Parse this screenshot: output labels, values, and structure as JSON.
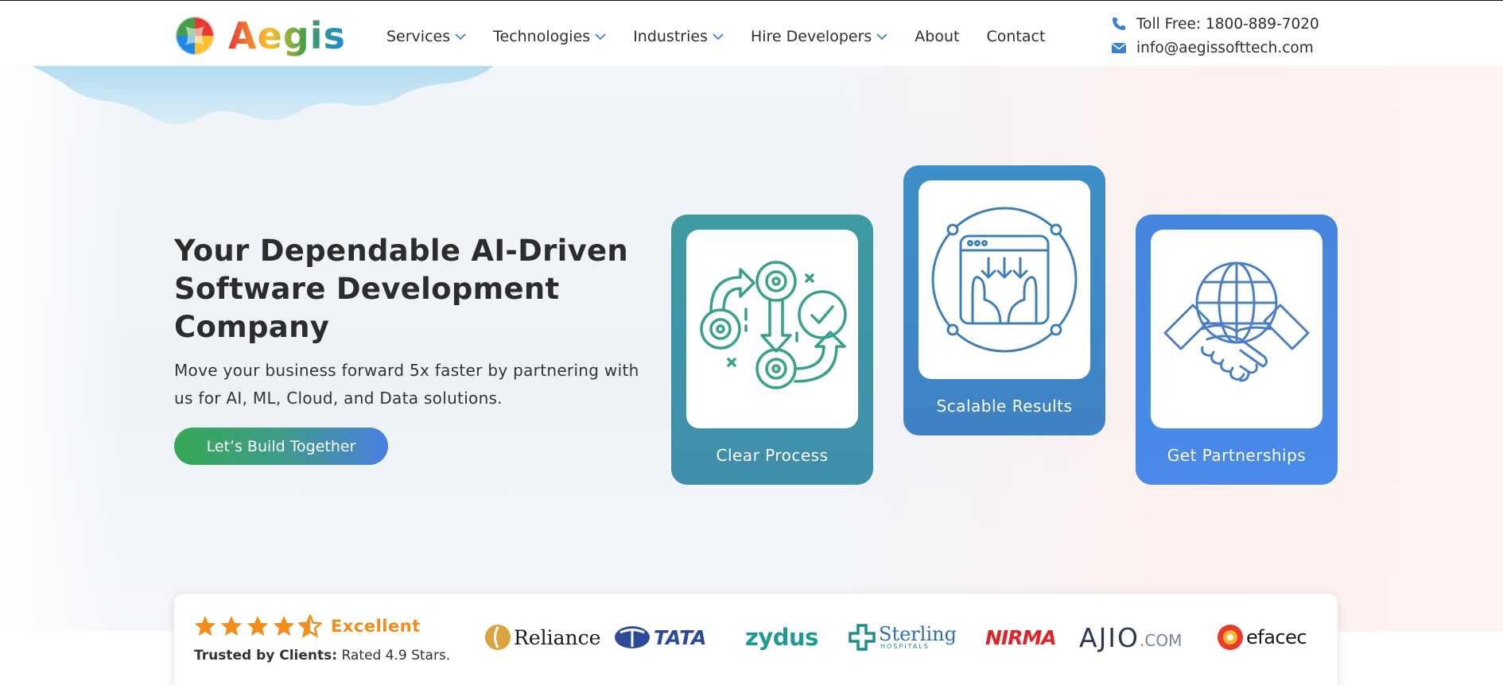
{
  "header": {
    "logo_text": "Aegis",
    "nav": [
      {
        "label": "Services",
        "dropdown": true
      },
      {
        "label": "Technologies",
        "dropdown": true
      },
      {
        "label": "Industries",
        "dropdown": true
      },
      {
        "label": "Hire Developers",
        "dropdown": true
      },
      {
        "label": "About",
        "dropdown": false
      },
      {
        "label": "Contact",
        "dropdown": false
      }
    ],
    "phone": "Toll Free: 1800-889-7020",
    "email": "info@aegissofttech.com"
  },
  "hero": {
    "title": "Your Dependable AI-Driven Software Development Company",
    "subtitle": "Move your business forward 5x faster by partnering with us for AI, ML, Cloud, and Data solutions.",
    "cta_label": "Let’s Build Together"
  },
  "cards": [
    {
      "label": "Clear Process",
      "icon": "process-flow-icon"
    },
    {
      "label": "Scalable Results",
      "icon": "scalable-hands-icon"
    },
    {
      "label": "Get Partnerships",
      "icon": "handshake-globe-icon"
    }
  ],
  "trust": {
    "rating_label": "Excellent",
    "rating_stars": 4.5,
    "trusted_bold": "Trusted by Clients:",
    "trusted_rest": " Rated 4.9 Stars.",
    "brands": [
      "Reliance",
      "TATA",
      "zydus",
      "Sterling",
      "HOSPITALS",
      "NIRMA",
      "AJIO",
      ".COM",
      "efacec"
    ]
  },
  "colors": {
    "star": "#f28c1a",
    "accent_blue": "#3d8fc7",
    "accent_green": "#34a853",
    "text_dark": "#2c2c2c"
  }
}
